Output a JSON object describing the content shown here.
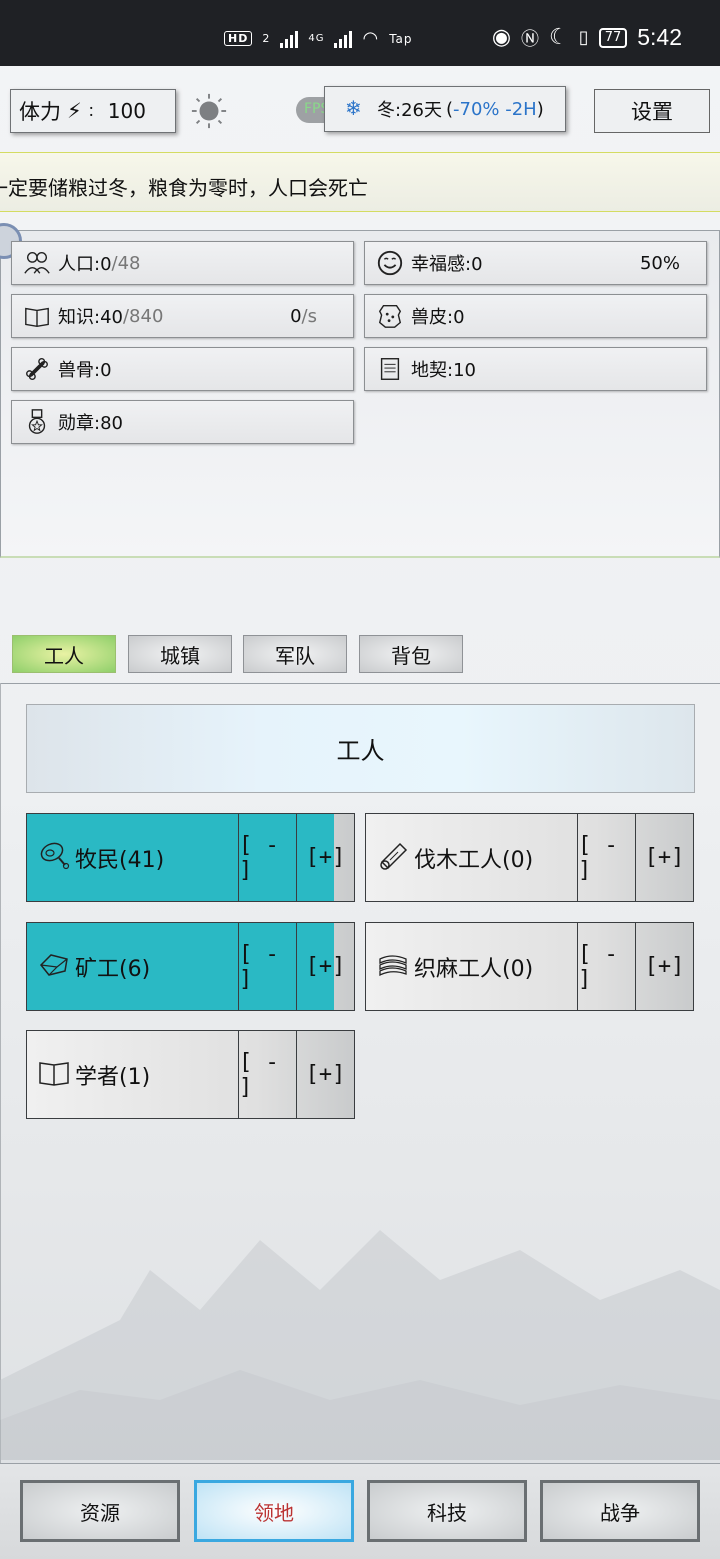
{
  "status_bar": {
    "left_badges": [
      "HD",
      "2",
      "4G",
      "Tap"
    ],
    "battery": "77",
    "time": "5:42"
  },
  "top": {
    "stamina_label": "体力",
    "stamina_sep": "：",
    "stamina_value": "100",
    "fps_text": "FPS:60",
    "season_text": "冬:26天",
    "season_mod": "-70% -2H",
    "season_open": "(",
    "season_close": ")",
    "settings_label": "设置"
  },
  "banner": {
    "message": "一定要储粮过冬，粮食为零时，人口会死亡"
  },
  "stats": {
    "population": {
      "label": "人口:0",
      "max": "/48"
    },
    "happiness": {
      "label": "幸福感:0",
      "percent": "50%"
    },
    "knowledge": {
      "label": "知识:40",
      "max": "/840",
      "rate": "0",
      "rate_unit": "/s"
    },
    "hide": {
      "label": "兽皮:0"
    },
    "bone": {
      "label": "兽骨:0"
    },
    "deed": {
      "label": "地契:10"
    },
    "medal": {
      "label": "勋章:80"
    }
  },
  "tabs": [
    {
      "label": "工人",
      "active": true
    },
    {
      "label": "城镇",
      "active": false
    },
    {
      "label": "军队",
      "active": false
    },
    {
      "label": "背包",
      "active": false
    }
  ],
  "section_title": "工人",
  "jobs": [
    {
      "label": "牧民(41)",
      "fill": 0.94,
      "minus": "[ - ]",
      "plus": "[+]",
      "icon": "meat-icon"
    },
    {
      "label": "伐木工人(0)",
      "fill": 0,
      "minus": "[ - ]",
      "plus": "[+]",
      "icon": "log-icon"
    },
    {
      "label": "矿工(6)",
      "fill": 0.94,
      "minus": "[ - ]",
      "plus": "[+]",
      "icon": "ore-icon"
    },
    {
      "label": "织麻工人(0)",
      "fill": 0,
      "minus": "[ - ]",
      "plus": "[+]",
      "icon": "fabric-icon"
    },
    {
      "label": "学者(1)",
      "fill": 0,
      "minus": "[ - ]",
      "plus": "[+]",
      "icon": "book-icon"
    }
  ],
  "bottom_nav": [
    {
      "label": "资源",
      "active": false
    },
    {
      "label": "领地",
      "active": true
    },
    {
      "label": "科技",
      "active": false
    },
    {
      "label": "战争",
      "active": false
    }
  ],
  "colors": {
    "status_bar": "#1f2125",
    "job_fill": "#2ab9c4",
    "season_mod": "#2b74c9",
    "active_tab": "#8fcf6a",
    "active_nav_border": "#3aa8e0"
  }
}
